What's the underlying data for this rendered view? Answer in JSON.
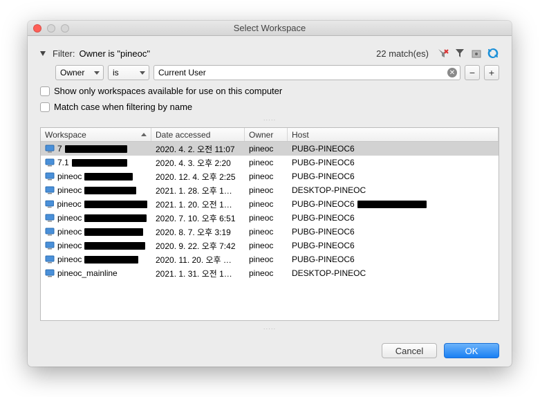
{
  "window": {
    "title": "Select Workspace"
  },
  "filter": {
    "label": "Filter:",
    "description": "Owner is \"pineoc\"",
    "matches_text": "22 match(es)"
  },
  "criteria": {
    "field": "Owner",
    "operator": "is",
    "value": "Current User"
  },
  "options": {
    "show_available": "Show only workspaces available for use on this computer",
    "match_case": "Match case when filtering by name"
  },
  "columns": {
    "workspace": "Workspace",
    "date": "Date accessed",
    "owner": "Owner",
    "host": "Host"
  },
  "rows": [
    {
      "ws_prefix": "7",
      "ws_redact": 90,
      "date": "2020. 4. 2. 오전 11:07",
      "owner": "pineoc",
      "host": "PUBG-PINEOC6",
      "host_redact": 0,
      "selected": true
    },
    {
      "ws_prefix": "7.1",
      "ws_redact": 80,
      "date": "2020. 4. 3. 오후 2:20",
      "owner": "pineoc",
      "host": "PUBG-PINEOC6",
      "host_redact": 0
    },
    {
      "ws_prefix": "pineoc",
      "ws_redact": 70,
      "date": "2020. 12. 4. 오후 2:25",
      "owner": "pineoc",
      "host": "PUBG-PINEOC6",
      "host_redact": 0
    },
    {
      "ws_prefix": "pineoc",
      "ws_redact": 75,
      "date": "2021. 1. 28. 오후 1…",
      "owner": "pineoc",
      "host": "DESKTOP-PINEOC",
      "host_redact": 0
    },
    {
      "ws_prefix": "pineoc",
      "ws_redact": 95,
      "date": "2021. 1. 20. 오전 1…",
      "owner": "pineoc",
      "host": "PUBG-PINEOC6",
      "host_redact": 100
    },
    {
      "ws_prefix": "pineoc",
      "ws_redact": 90,
      "date": "2020. 7. 10. 오후 6:51",
      "owner": "pineoc",
      "host": "PUBG-PINEOC6",
      "host_redact": 0
    },
    {
      "ws_prefix": "pineoc",
      "ws_redact": 85,
      "date": "2020. 8. 7. 오후 3:19",
      "owner": "pineoc",
      "host": "PUBG-PINEOC6",
      "host_redact": 0
    },
    {
      "ws_prefix": "pineoc",
      "ws_redact": 88,
      "date": "2020. 9. 22. 오후 7:42",
      "owner": "pineoc",
      "host": "PUBG-PINEOC6",
      "host_redact": 0
    },
    {
      "ws_prefix": "pineoc",
      "ws_redact": 78,
      "date": "2020. 11. 20. 오후 …",
      "owner": "pineoc",
      "host": "PUBG-PINEOC6",
      "host_redact": 0
    },
    {
      "ws_prefix": "pineoc_mainline",
      "ws_redact": 0,
      "date": "2021. 1. 31. 오전 1…",
      "owner": "pineoc",
      "host": "DESKTOP-PINEOC",
      "host_redact": 0
    }
  ],
  "buttons": {
    "cancel": "Cancel",
    "ok": "OK"
  }
}
